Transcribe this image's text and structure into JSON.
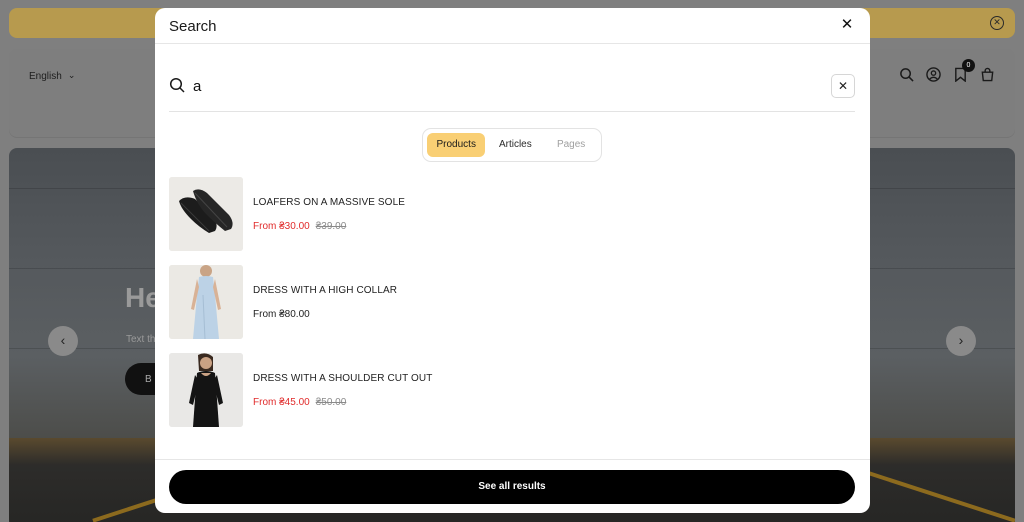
{
  "background_page": {
    "language": "English",
    "cart_badge_count": "0",
    "hero_title": "He",
    "hero_text": "Text th",
    "hero_button": "B"
  },
  "modal": {
    "title": "Search",
    "search": {
      "value": "a"
    },
    "tabs": [
      {
        "label": "Products",
        "active": true
      },
      {
        "label": "Articles",
        "active": false
      },
      {
        "label": "Pages",
        "active": false
      }
    ],
    "results": [
      {
        "name": "LOAFERS ON A MASSIVE SOLE",
        "price": "From ₴30.00",
        "compare_price": "₴39.00",
        "on_sale": true,
        "image": "loafers"
      },
      {
        "name": "DRESS WITH A HIGH COLLAR",
        "price": "From ₴80.00",
        "compare_price": "",
        "on_sale": false,
        "image": "blue-dress"
      },
      {
        "name": "DRESS WITH A SHOULDER CUT OUT",
        "price": "From ₴45.00",
        "compare_price": "₴50.00",
        "on_sale": true,
        "image": "black-dress"
      }
    ],
    "see_all_label": "See all results"
  },
  "colors": {
    "active_tab": "#f9cf74",
    "sale_price": "#e02b2b",
    "announcement_bar": "#b79a4e",
    "primary_button": "#000000"
  }
}
